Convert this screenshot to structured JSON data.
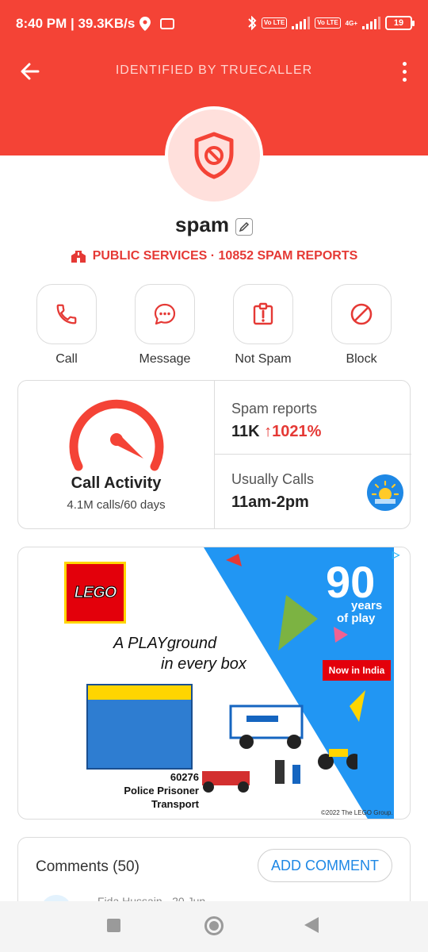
{
  "status_bar": {
    "time": "8:40 PM | 39.3KB/s",
    "volte1": "Vo LTE",
    "volte2": "Vo LTE",
    "net": "4G+",
    "battery": "19"
  },
  "header": {
    "title": "IDENTIFIED BY TRUECALLER"
  },
  "profile": {
    "name": "spam",
    "category": "PUBLIC SERVICES · 10852 SPAM REPORTS",
    "accent_color": "#F44336"
  },
  "actions": [
    {
      "label": "Call",
      "icon": "phone-icon"
    },
    {
      "label": "Message",
      "icon": "chat-icon"
    },
    {
      "label": "Not Spam",
      "icon": "alert-icon"
    },
    {
      "label": "Block",
      "icon": "block-icon"
    }
  ],
  "stats": {
    "activity_title": "Call Activity",
    "activity_sub": "4.1M calls/60 days",
    "spam_label": "Spam reports",
    "spam_value": "11K",
    "spam_growth": "1021%",
    "calls_label": "Usually Calls",
    "calls_value": "11am-2pm"
  },
  "ad": {
    "brand": "LEGO",
    "tagline_1": "A PLAYground",
    "tagline_2": "in every box",
    "set_number": "60276",
    "set_name_1": "Police Prisoner",
    "set_name_2": "Transport",
    "years_number": "90",
    "years_1": "years",
    "years_2": "of play",
    "cta": "Now in India",
    "copyright": "©2022 The LEGO Group.",
    "adchoice": "▷"
  },
  "comments": {
    "title": "Comments (50)",
    "add_label": "ADD COMMENT",
    "peek_text": "Fida Hussain · 20 Jun"
  }
}
